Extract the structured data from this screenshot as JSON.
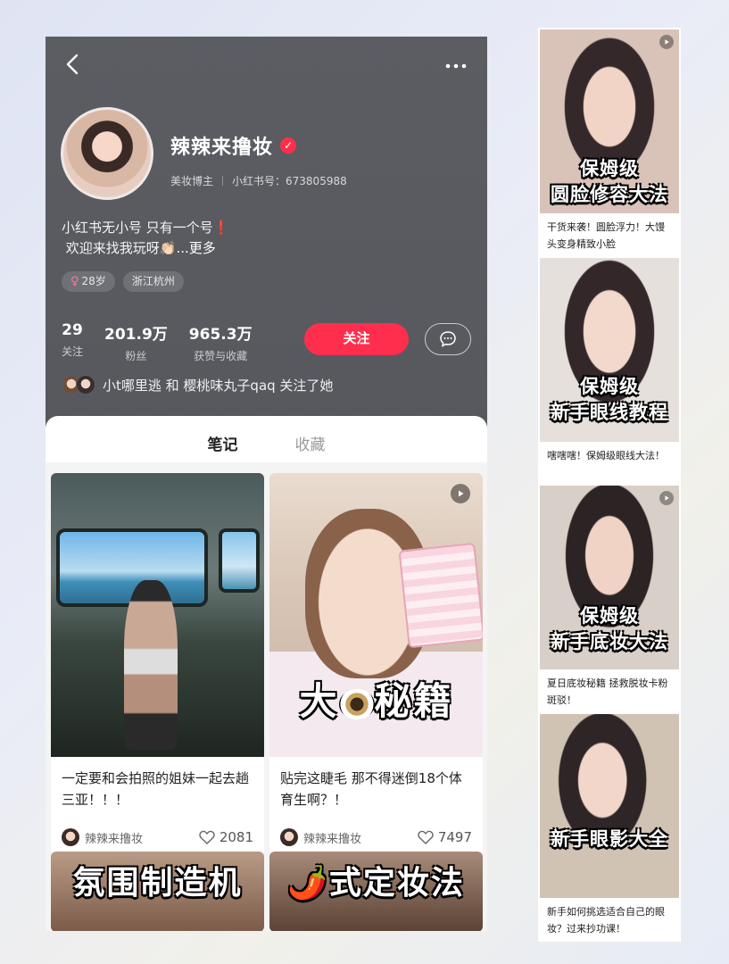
{
  "profile": {
    "nickname": "辣辣来撸妆",
    "verified_mark": "✓",
    "role": "美妆博主",
    "id_label": "小红书号：673805988",
    "bio_line1": "小红书无小号 只有一个号❗️",
    "bio_line2": "欢迎来找我玩呀👏🏻",
    "bio_more": "...更多",
    "tags": [
      {
        "icon": "female-icon",
        "symbol": "♀",
        "label": "28岁"
      },
      {
        "label": "浙江杭州"
      }
    ],
    "stats": [
      {
        "value": "29",
        "label": "关注"
      },
      {
        "value": "201.9万",
        "label": "粉丝"
      },
      {
        "value": "965.3万",
        "label": "获赞与收藏"
      }
    ],
    "follow_label": "关注",
    "followed_by": "小t哪里逃 和 樱桃味丸子qaq 关注了她"
  },
  "tabs": [
    {
      "label": "笔记",
      "active": true
    },
    {
      "label": "收藏",
      "active": false
    }
  ],
  "cards": [
    {
      "title": "一定要和会拍照的姐妹一起去趟三亚！！！",
      "author": "辣辣来撸妆",
      "likes": "2081",
      "overlay": ""
    },
    {
      "title": "贴完这睫毛 那不得迷倒18个体育生啊？！",
      "author": "辣辣来撸妆",
      "likes": "7497",
      "overlay_left": "大",
      "overlay_right": "秘籍"
    }
  ],
  "partial_cards": [
    {
      "overlay": "氛围制造机"
    },
    {
      "overlay": "式定妆法",
      "emoji": "🌶️"
    }
  ],
  "side_cards": [
    {
      "overlay1": "保姆级",
      "overlay2": "圆脸修容大法",
      "caption": "干货来袭！圆脸浮力！大馒头变身精致小脸"
    },
    {
      "overlay1": "保姆级",
      "overlay2": "新手眼线教程",
      "caption": "嗐嗐嗐！保姆级眼线大法！"
    },
    {
      "overlay1": "保姆级",
      "overlay2": "新手底妆大法",
      "caption": "夏日底妆秘籍 拯救脱妆卡粉斑驳！"
    },
    {
      "overlay1": "",
      "overlay2": "新手眼影大全",
      "caption": "新手如何挑选适合自己的眼妆？过来抄功课！"
    }
  ],
  "colors": {
    "accent": "#ff2e4d",
    "header_bg": "#5a5c62"
  }
}
